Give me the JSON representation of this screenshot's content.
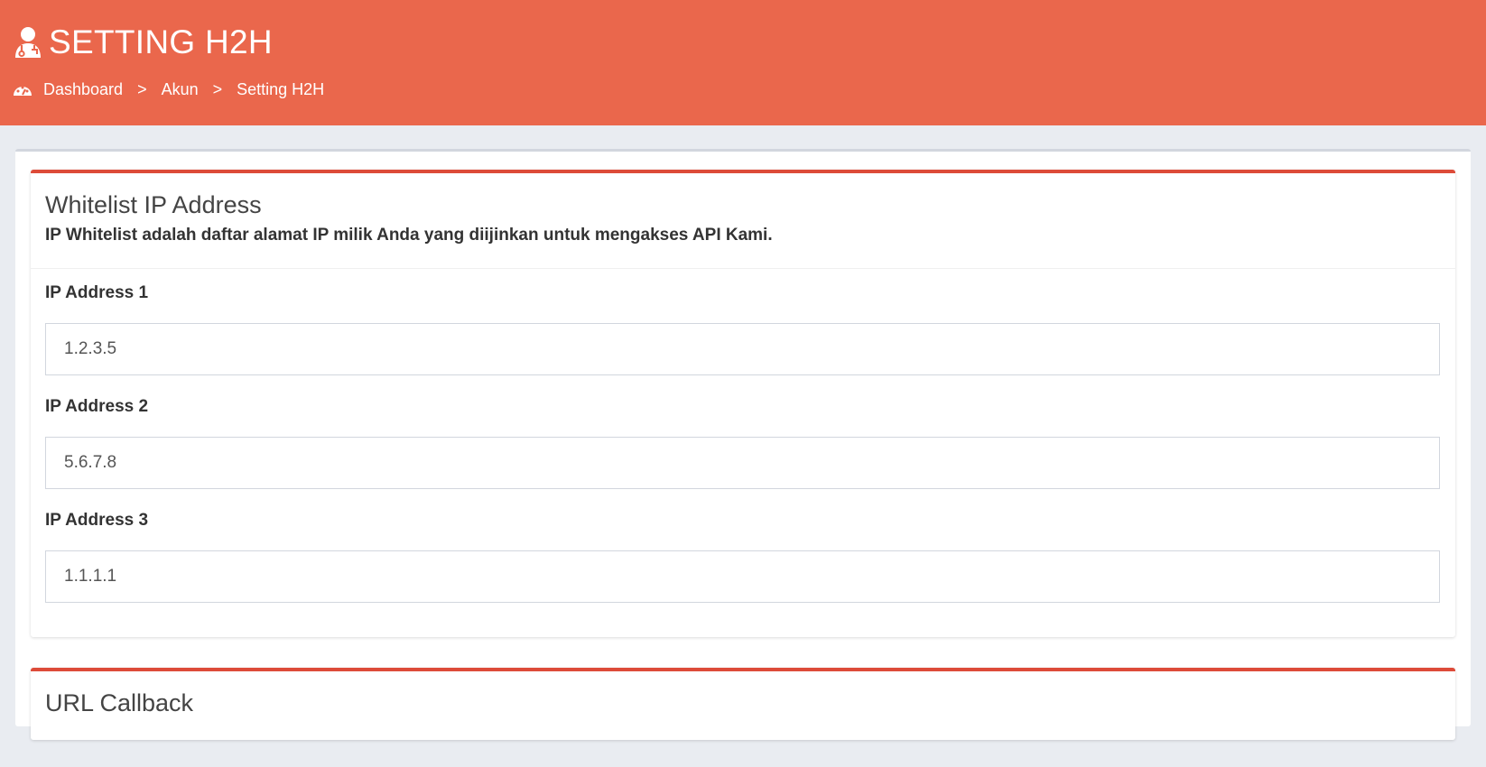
{
  "header": {
    "title": "SETTING H2H",
    "title_icon": "user-doctor-icon",
    "accent_color": "#ea674c"
  },
  "breadcrumb": {
    "icon": "dashboard-gauge-icon",
    "items": [
      "Dashboard",
      "Akun",
      "Setting H2H"
    ],
    "separator": ">"
  },
  "whitelist": {
    "title": "Whitelist IP Address",
    "subtitle": "IP Whitelist adalah daftar alamat IP milik Anda yang diijinkan untuk mengakses API Kami.",
    "fields": [
      {
        "label": "IP Address 1",
        "value": "1.2.3.5"
      },
      {
        "label": "IP Address 2",
        "value": "5.6.7.8"
      },
      {
        "label": "IP Address 3",
        "value": "1.1.1.1"
      }
    ]
  },
  "callback": {
    "title": "URL Callback"
  }
}
